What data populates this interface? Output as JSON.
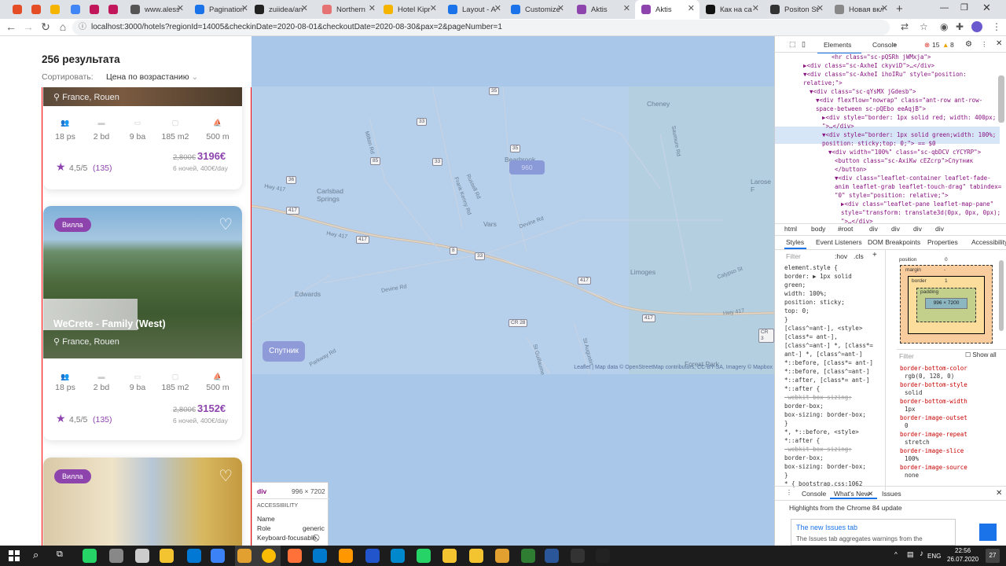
{
  "browser": {
    "tabs": [
      {
        "label": "",
        "color": "#e44d26"
      },
      {
        "label": "",
        "color": "#e44d26"
      },
      {
        "label": "",
        "color": "#f4b400"
      },
      {
        "label": "",
        "color": "#4285f4"
      },
      {
        "label": "",
        "color": "#c2185b"
      },
      {
        "label": "",
        "color": "#c2185b"
      },
      {
        "label": "www.alessi",
        "color": "#555555"
      },
      {
        "label": "Pagination",
        "color": "#1a73e8"
      },
      {
        "label": "zuiidea/an",
        "color": "#222222"
      },
      {
        "label": "Northern",
        "color": "#e57373"
      },
      {
        "label": "Hotel Kipr",
        "color": "#f4b400"
      },
      {
        "label": "Layout - A",
        "color": "#1a73e8"
      },
      {
        "label": "Customize",
        "color": "#1a73e8"
      },
      {
        "label": "Aktis",
        "color": "#8e44ad"
      },
      {
        "label": "Aktis",
        "color": "#8e44ad",
        "active": true
      },
      {
        "label": "Как на са",
        "color": "#111111"
      },
      {
        "label": "Positon St",
        "color": "#333333"
      },
      {
        "label": "Новая вкладка",
        "color": "#888888"
      }
    ],
    "new_tab": "+",
    "url": "localhost:3000/hotels?regionId=14005&checkinDate=2020-08-01&checkoutDate=2020-08-30&pax=2&pageNumber=1"
  },
  "page": {
    "results_count": "256 результата",
    "sort_label": "Сортировать:",
    "sort_value": "Цена по возрастанию",
    "cards": [
      {
        "location": "France, Rouen",
        "features": [
          "18 ps",
          "2 bd",
          "9 ba",
          "185 m2",
          "500 m"
        ],
        "old_price": "2,800€",
        "new_price": "3196€",
        "rating": "4,5/5",
        "reviews": "(135)",
        "nights": "6 ночей, 400€/day"
      },
      {
        "badge": "Вилла",
        "title": "WeCrete - Family (West)",
        "location": "France, Rouen",
        "features": [
          "18 ps",
          "2 bd",
          "9 ba",
          "185 m2",
          "500 m"
        ],
        "old_price": "2,800€",
        "new_price": "3152€",
        "rating": "4,5/5",
        "reviews": "(135)",
        "nights": "6 ночей, 400€/day"
      },
      {
        "badge": "Вилла"
      }
    ]
  },
  "map": {
    "places": [
      "Cheney",
      "Bearbrook",
      "Carlsbad Springs",
      "Vars",
      "Edwards",
      "Limoges",
      "Forest Park",
      "Larose F"
    ],
    "roads": [
      "Milton Rd",
      "Frank Kenny Rd",
      "Russell Rd",
      "Devine Rd",
      "Calypso St",
      "Hwy 417",
      "Parkway Rd",
      "St Guillaume",
      "St Augustin",
      "Saumure Rd",
      "Devine Rd",
      "Hwy 417",
      "Hwy 417"
    ],
    "shields": [
      "35",
      "33",
      "85",
      "36",
      "417",
      "417",
      "8",
      "33",
      "417",
      "CR 28",
      "CR 3",
      "35",
      "33",
      "417"
    ],
    "highlight_number": "960",
    "sputnik_button": "Спутник",
    "attribution": "Leaflet | Map data © OpenStreetMap contributors, CC-BY-SA, Imagery © Mapbox"
  },
  "tooltip": {
    "tag": "div",
    "size": "996 × 7202",
    "section": "ACCESSIBILITY",
    "rows": [
      [
        "Name",
        ""
      ],
      [
        "Role",
        "generic"
      ],
      [
        "Keyboard-focusable",
        "⃠"
      ]
    ]
  },
  "devtools": {
    "tabs": [
      "Elements",
      "Console"
    ],
    "errors": "15",
    "warnings": "8",
    "dom_lines": [
      "<hr class=\"sc-pQSRh jWMxja\">",
      "▶<div class=\"sc-AxheI ckyviD\">…</div>",
      "▼<div class=\"sc-AxheI ihoIRu\" style=\"position:",
      "relative;\">",
      "▼<div class=\"sc-qYsMX jGdesb\">",
      "▼<div flexflow=\"nowrap\" class=\"ant-row ant-row-",
      "space-between sc-pQEbo eeAqjB\">",
      "▶<div style=\"border: 1px solid red; width: 400px;",
      "\">…</div>",
      "▼<div style=\"border: 1px solid green;width: 100%;",
      "position: sticky;top: 0;\"> == $0",
      "▼<div width=\"100%\" class=\"sc-qbDCV cYCYRP\">",
      "<button class=\"sc-AxiKw cEZcrp\">Спутник",
      "</button>",
      "▼<div class=\"leaflet-container leaflet-fade-",
      "anim leaflet-grab leaflet-touch-drag\" tabindex=",
      "\"0\" style=\"position: relative;\">",
      "▶<div class=\"leaflet-pane leaflet-map-pane\"",
      "style=\"transform: translate3d(0px, 0px, 0px);",
      "\">…</div>"
    ],
    "breadcrumbs": [
      "html",
      "body",
      "#root",
      "div",
      "div",
      "div",
      "div"
    ],
    "subtabs": [
      "Styles",
      "Event Listeners",
      "DOM Breakpoints",
      "Properties",
      "Accessibility"
    ],
    "filter": "Filter",
    "hov": ":hov",
    "cls": ".cls",
    "style_lines": [
      "element.style {",
      "  border: ▶ 1px solid",
      "    green;",
      "  width: 100%;",
      "  position: sticky;",
      "  top: 0;",
      "}",
      "[class^=ant-],    <style>",
      "[class*= ant-],",
      "[class^=ant-] *, [class*=",
      "ant-] *, [class^=ant-]",
      "*::before, [class*= ant-]",
      "*::before, [class^=ant-]",
      "*::after, [class*= ant-]",
      "*::after {",
      "  -webkit-box-sizing:",
      "    border-box;",
      "  box-sizing: border-box;",
      "}",
      "*, *::before,     <style>",
      "*::after {",
      "  -webkit-box-sizing:",
      "    border-box;",
      "  box-sizing: border-box;",
      "}",
      "* {       bootstrap.css:1062"
    ],
    "boxmodel": {
      "position": "position",
      "pos_val": "0",
      "margin": "margin",
      "border": "border",
      "padding": "padding",
      "content": "996 × 7200",
      "dash": "-",
      "one": "1"
    },
    "computed_filter": "Filter",
    "show_all": "Show all",
    "computed": [
      [
        "border-bottom-color",
        "rgb(0, 128, 0)"
      ],
      [
        "border-bottom-style",
        "solid"
      ],
      [
        "border-bottom-width",
        "1px"
      ],
      [
        "border-image-outset",
        "0"
      ],
      [
        "border-image-repeat",
        "stretch"
      ],
      [
        "border-image-slice",
        "100%"
      ],
      [
        "border-image-source",
        "none"
      ]
    ],
    "drawer_tabs": [
      "Console",
      "What's New",
      "Issues"
    ],
    "drawer_heading": "Highlights from the Chrome 84 update",
    "drawer_card_title": "The new Issues tab",
    "drawer_card_text": "The Issues tab aggregates warnings from the"
  },
  "taskbar": {
    "lang": "ENG",
    "time": "22:56",
    "date": "26.07.2020",
    "notif": "27"
  }
}
